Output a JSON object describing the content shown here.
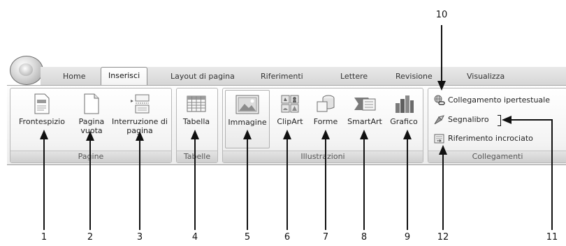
{
  "tabs": [
    {
      "label": "Home",
      "active": false
    },
    {
      "label": "Inserisci",
      "active": true
    },
    {
      "label": "Layout di pagina",
      "active": false
    },
    {
      "label": "Riferimenti",
      "active": false
    },
    {
      "label": "Lettere",
      "active": false
    },
    {
      "label": "Revisione",
      "active": false
    },
    {
      "label": "Visualizza",
      "active": false
    }
  ],
  "groups": {
    "pagine": {
      "label": "Pagine",
      "buttons": [
        "Frontespizio",
        "Pagina vuota",
        "Interruzione di pagina"
      ]
    },
    "tabelle": {
      "label": "Tabelle",
      "buttons": [
        "Tabella"
      ]
    },
    "illustrazioni": {
      "label": "Illustrazioni",
      "buttons": [
        "Immagine",
        "ClipArt",
        "Forme",
        "SmartArt",
        "Grafico"
      ]
    },
    "collegamenti": {
      "label": "Collegamenti",
      "buttons": [
        "Collegamento ipertestuale",
        "Segnalibro",
        "Riferimento incrociato"
      ]
    }
  },
  "callouts": [
    "1",
    "2",
    "3",
    "4",
    "5",
    "6",
    "7",
    "8",
    "9",
    "10",
    "11",
    "12"
  ],
  "colors": {
    "ribbon_bg": "#f4f4f4",
    "tab_strip": "#dcdcdc",
    "callout_line": "#111111"
  }
}
